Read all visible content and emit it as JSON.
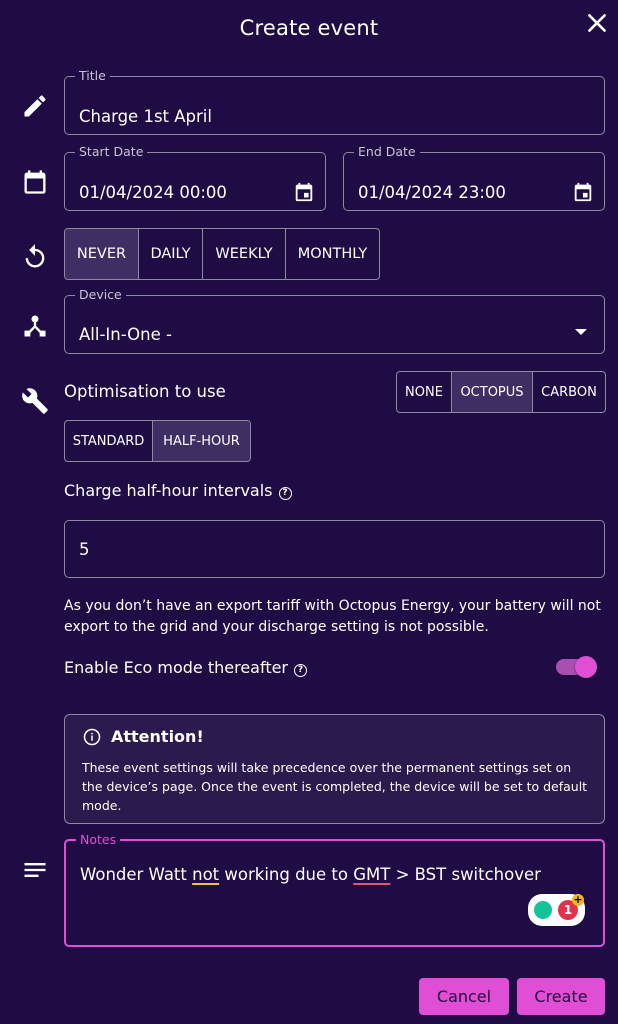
{
  "dialog": {
    "title": "Create event",
    "close_icon": "close-icon"
  },
  "title_field": {
    "label": "Title",
    "value": "Charge 1st April",
    "icon": "pencil-icon"
  },
  "dates": {
    "icon": "calendar-icon",
    "start": {
      "label": "Start Date",
      "value": "01/04/2024 00:00"
    },
    "end": {
      "label": "End Date",
      "value": "01/04/2024 23:00"
    }
  },
  "repeat": {
    "icon": "repeat-icon",
    "options": [
      "NEVER",
      "DAILY",
      "WEEKLY",
      "MONTHLY"
    ],
    "selected": "NEVER"
  },
  "device": {
    "label": "Device",
    "value": "All-In-One -",
    "icon": "device-hub-icon"
  },
  "optimisation": {
    "icon": "wrench-icon",
    "label": "Optimisation to use",
    "options": [
      "NONE",
      "OCTOPUS",
      "CARBON"
    ],
    "selected": "OCTOPUS",
    "mode_options": [
      "STANDARD",
      "HALF-HOUR"
    ],
    "mode_selected": "HALF-HOUR"
  },
  "intervals": {
    "label": "Charge half-hour intervals",
    "value": "5"
  },
  "export_note": "As you don’t have an export tariff with Octopus Energy, your battery will not export to the grid and your discharge setting is not possible.",
  "eco": {
    "label": "Enable Eco mode thereafter",
    "enabled": true
  },
  "attention": {
    "title": "Attention!",
    "body": "These event settings will take precedence over the permanent settings set on the device’s page. Once the event is completed, the device will be set to default mode."
  },
  "notes": {
    "label": "Notes",
    "icon": "notes-icon",
    "value_parts": [
      "Wonder Watt ",
      "not",
      " working due to ",
      "GMT",
      " > BST switchover"
    ],
    "grammar_badge": "1",
    "grammar_plus": "+"
  },
  "actions": {
    "cancel": "Cancel",
    "create": "Create"
  },
  "colors": {
    "background": "#200c45",
    "accent": "#e04ed6",
    "selected_segment": "#3f2e63",
    "border": "#8c8a9c"
  }
}
